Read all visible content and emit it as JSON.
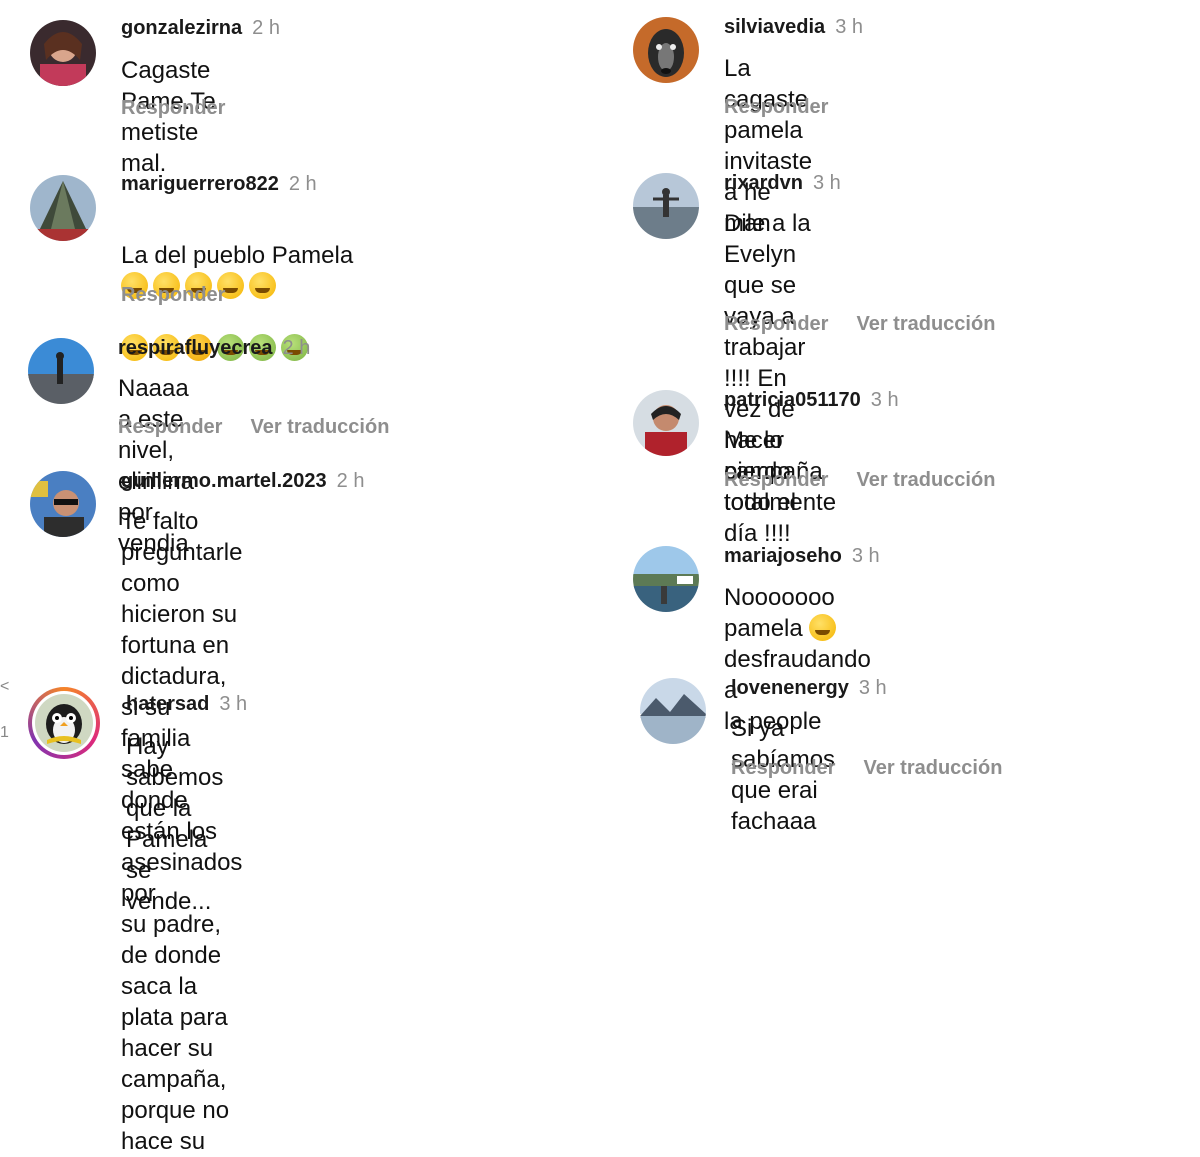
{
  "actions": {
    "reply": "Responder",
    "translate": "Ver traducción"
  },
  "edge_glyphs": [
    "<",
    "1"
  ],
  "left_comments": [
    {
      "username": "gonzalezirna",
      "time": "2 h",
      "text": "Cagaste Pame.Te metiste mal."
    },
    {
      "username": "mariguerrero822",
      "time": "2 h",
      "text": "La del pueblo Pamela",
      "emojis": [
        "grinning-sweat-emoji",
        "grinning-sweat-emoji",
        "grinning-sweat-emoji",
        "grinning-sweat-emoji",
        "money-mouth-emoji",
        "money-mouth-emoji",
        "money-mouth-emoji",
        "hugging-emoji",
        "nauseated-emoji",
        "nauseated-emoji",
        "nauseated-emoji"
      ]
    },
    {
      "username": "respirafluyecrea",
      "time": "2 h",
      "text": "Naaaa a este nivel, elimina por vendia"
    },
    {
      "username": "guillermo.martel.2023",
      "time": "2 h",
      "text": "Te falto preguntarle como hicieron su\nfortuna en dictadura, si su familia\nsabe donde están los asesinados por\nsu padre, de donde saca la plata para\nhacer su campaña, porque no hace su"
    },
    {
      "username": "hatersad",
      "time": "3 h",
      "text": "Hay sabemos que la Pamela se\nvende..."
    }
  ],
  "right_comments": [
    {
      "username": "silviavedia",
      "time": "3 h",
      "text": "La cagaste pamela invitaste a he man"
    },
    {
      "username": "rixardvn",
      "time": "3 h",
      "text": "Dile a la Evelyn que se vaya a\ntrabajar !!!! En vez de hacer campaña\ntodo el día !!!!"
    },
    {
      "username": "patricia051170",
      "time": "3 h",
      "text": "Me lo pierdo totalmente"
    },
    {
      "username": "mariajoseho",
      "time": "3 h",
      "text_before": "Nooooooo pamela",
      "text_after": "desfraudando a\nla people",
      "emoji": "crying-emoji"
    },
    {
      "username": "lovenenergy",
      "time": "3 h",
      "text": "Si ya sabíamos que erai fachaaa"
    }
  ],
  "colors": {
    "username": "#1a1a1a",
    "meta": "#8e8e8e",
    "text": "#111111"
  }
}
